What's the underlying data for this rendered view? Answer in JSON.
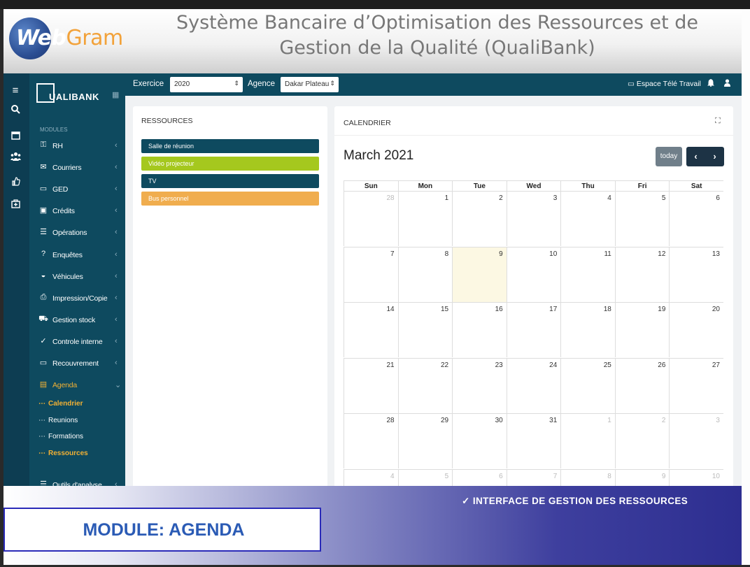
{
  "banner": {
    "logo_web": "Web",
    "logo_gram": "Gram",
    "title_line1": "Système Bancaire d’Optimisation des Ressources et de",
    "title_line2": "Gestion de la Qualité (QualiBank)"
  },
  "brand": {
    "name_q": "Q",
    "name_rest": "UALIBANK"
  },
  "sidebar": {
    "modules_label": "MODULES",
    "items": [
      {
        "label": "RH",
        "icon": "key-icon"
      },
      {
        "label": "Courriers",
        "icon": "mail-icon"
      },
      {
        "label": "GED",
        "icon": "folder-icon"
      },
      {
        "label": "Crédits",
        "icon": "briefcase-icon"
      },
      {
        "label": "Opérations",
        "icon": "list-icon"
      },
      {
        "label": "Enquêtes",
        "icon": "question-icon"
      },
      {
        "label": "Véhicules",
        "icon": "car-icon"
      },
      {
        "label": "Impression/Copie",
        "icon": "printer-icon"
      },
      {
        "label": "Gestion stock",
        "icon": "cart-icon"
      },
      {
        "label": "Controle interne",
        "icon": "check-circle-icon"
      },
      {
        "label": "Recouvrement",
        "icon": "folder-icon"
      },
      {
        "label": "Agenda",
        "icon": "calendar-icon"
      }
    ],
    "sub_items": [
      {
        "label": "Calendrier",
        "active": true
      },
      {
        "label": "Reunions",
        "active": false
      },
      {
        "label": "Formations",
        "active": false
      },
      {
        "label": "Ressources",
        "active": true
      }
    ],
    "last_item": "Outils d'analyse"
  },
  "topbar": {
    "exercice_label": "Exercice",
    "exercice_value": "2020",
    "agence_label": "Agence",
    "agence_value": "Dakar Plateau",
    "telework": "Espace Télé Travail"
  },
  "resources": {
    "title": "RESSOURCES",
    "items": [
      {
        "label": "Salle de réunion",
        "color": "#0e4a5f"
      },
      {
        "label": "Vidéo projecteur",
        "color": "#a5c81e"
      },
      {
        "label": "TV",
        "color": "#0e4a5f"
      },
      {
        "label": "Bus personnel",
        "color": "#f0ad4e"
      }
    ]
  },
  "calendar": {
    "title": "CALENDRIER",
    "month": "March 2021",
    "today_label": "today",
    "prev": "‹",
    "next": "›",
    "days_of_week": [
      "Sun",
      "Mon",
      "Tue",
      "Wed",
      "Thu",
      "Fri",
      "Sat"
    ],
    "weeks": [
      [
        "28",
        "1",
        "2",
        "3",
        "4",
        "5",
        "6"
      ],
      [
        "7",
        "8",
        "9",
        "10",
        "11",
        "12",
        "13"
      ],
      [
        "14",
        "15",
        "16",
        "17",
        "18",
        "19",
        "20"
      ],
      [
        "21",
        "22",
        "23",
        "24",
        "25",
        "26",
        "27"
      ],
      [
        "28",
        "29",
        "30",
        "31",
        "1",
        "2",
        "3"
      ],
      [
        "4",
        "5",
        "6",
        "7",
        "8",
        "9",
        "10"
      ]
    ],
    "today_day": "9"
  },
  "bottom": {
    "module_label": "MODULE: AGENDA",
    "check_label": "✓  INTERFACE  DE  GESTION  DES  RESSOURCES"
  }
}
